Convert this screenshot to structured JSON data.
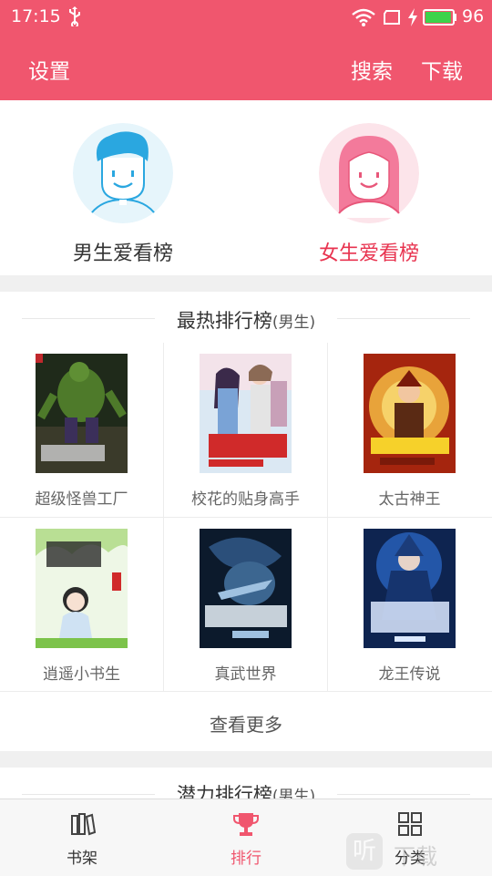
{
  "status_bar": {
    "time": "17:15",
    "battery": "96",
    "battery_level": 0.96,
    "icons": [
      "usb-icon",
      "wifi-icon",
      "sim-icon",
      "charging-icon",
      "battery-icon"
    ]
  },
  "app_bar": {
    "settings": "设置",
    "search": "搜索",
    "download": "下载"
  },
  "gender": {
    "male_label": "男生爱看榜",
    "female_label": "女生爱看榜"
  },
  "hot_rank": {
    "title": "最热排行榜",
    "subtitle": "(男生)",
    "books": [
      {
        "name": "超级怪兽工厂"
      },
      {
        "name": "校花的贴身高手"
      },
      {
        "name": "太古神王"
      },
      {
        "name": "逍遥小书生"
      },
      {
        "name": "真武世界"
      },
      {
        "name": "龙王传说"
      }
    ],
    "more": "查看更多"
  },
  "potential_rank": {
    "title": "潜力排行榜",
    "subtitle": "(男生)"
  },
  "tabs": [
    {
      "label": "书架",
      "icon": "bookshelf-icon"
    },
    {
      "label": "排行",
      "icon": "trophy-icon"
    },
    {
      "label": "分类",
      "icon": "grid-icon"
    }
  ],
  "watermark": {
    "badge": "听",
    "text": "下载"
  },
  "colors": {
    "accent": "#f0566e",
    "female": "#e8334f",
    "male_hair": "#2aa7e0"
  }
}
